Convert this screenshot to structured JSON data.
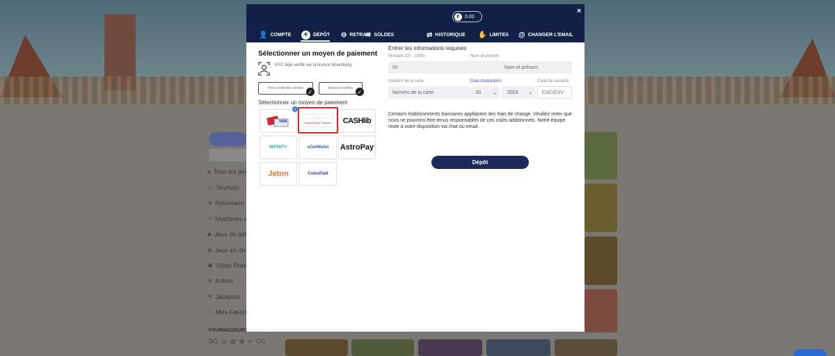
{
  "background": {
    "side_button": "Cat",
    "side_search": "Chercher",
    "side_menu": [
      {
        "icon": "cards-icon",
        "glyph": "♠",
        "label": "Tous les jeux"
      },
      {
        "icon": "trophy-icon",
        "glyph": "☆",
        "label": "Tournois"
      },
      {
        "icon": "new-icon",
        "glyph": "✦",
        "label": "Nouveaux"
      },
      {
        "icon": "slot-icon",
        "glyph": "✧",
        "label": "Machines à sous"
      },
      {
        "icon": "table-icon",
        "glyph": "♣",
        "label": "Jeux de table"
      },
      {
        "icon": "live-icon",
        "glyph": "◈",
        "label": "Jeux en direct"
      },
      {
        "icon": "poker-icon",
        "glyph": "◉",
        "label": "Vidéo Poker"
      },
      {
        "icon": "other-icon",
        "glyph": "✳",
        "label": "Autres"
      },
      {
        "icon": "jackpot-icon",
        "glyph": "✶",
        "label": "Jackpots"
      },
      {
        "icon": "heart-icon",
        "glyph": "♡",
        "label": "Mes Favoris"
      }
    ],
    "providers_title": "FOURNISSEURS",
    "provider_icons": [
      "BG",
      "◎",
      "◍",
      "❀",
      "∞",
      "GG"
    ]
  },
  "modal": {
    "balance": "0.00",
    "balance_coin": "€",
    "close": "×",
    "tabs": [
      {
        "id": "compte",
        "icon": "user-icon",
        "glyph": "👤",
        "label": "COMPTE",
        "active": false
      },
      {
        "id": "depot",
        "icon": "plus-circle-icon",
        "glyph": "+",
        "label": "DÉPÔT",
        "active": true
      },
      {
        "id": "retrait",
        "icon": "minus-circle-icon",
        "glyph": "⊖",
        "label": "RETRAIT",
        "active": false
      },
      {
        "id": "soldes",
        "icon": "coins-icon",
        "glyph": "≋",
        "label": "SOLDES",
        "active": false
      },
      {
        "id": "historique",
        "icon": "arrows-icon",
        "glyph": "⇄",
        "label": "HISTORIQUE",
        "active": false
      },
      {
        "id": "limites",
        "icon": "hand-icon",
        "glyph": "✋",
        "label": "LIMITES",
        "active": false
      },
      {
        "id": "changer-email",
        "icon": "at-icon",
        "glyph": "@",
        "label": "CHANGER L'EMAIL",
        "active": false
      }
    ],
    "left": {
      "title": "Sélectionner un moyen de paiement",
      "kyc_text": "KYC déjà vérifié sur la licence Mountberg",
      "verif_id_placeholder": "Pièce d'identité vérifiée",
      "verif_address_placeholder": "Adresse vérifiée",
      "subtitle": "Sélectionner un moyen de paiement",
      "methods": [
        {
          "id": "visa",
          "label": "VISA"
        },
        {
          "id": "instant-bank-transfer",
          "label": "Instant Bank Transfer"
        },
        {
          "id": "cashlib",
          "label": "CASHlib"
        },
        {
          "id": "mifinity",
          "label": "MiFINITY"
        },
        {
          "id": "ezeewallet",
          "label": "eZeeWallet"
        },
        {
          "id": "astropay",
          "label": "AstroPay"
        },
        {
          "id": "jeton",
          "label": "Jeton"
        },
        {
          "id": "coinspaid",
          "label": "CoinsPaid"
        }
      ],
      "selected_method": "instant-bank-transfer"
    },
    "right": {
      "title": "Entrer les informations requises",
      "amount_label": "Montant (20 - 1000)",
      "amount_value": "50",
      "name_label": "Nom et prénom",
      "name_placeholder": "Nom et prénom",
      "card_label": "Numéro de la carte",
      "card_placeholder": "Numéro de la carte",
      "expiry_label": "Date d'expiration",
      "expiry_month": "01",
      "expiry_year": "2023",
      "cvc_label": "Code de sécurité",
      "cvc_placeholder": "CVC/CVV",
      "notice": "Certains établissements bancaires appliquent des frais de change. Veuillez noter que nous ne pouvons être tenus responsables de ces coûts additionnels. Notre équipe reste à votre disposition via chat ou email.",
      "submit_label": "Dépôt"
    }
  },
  "colors": {
    "header_bg": "#102046",
    "accent_blue": "#1c2a5a",
    "selected_border": "#d7262f"
  }
}
